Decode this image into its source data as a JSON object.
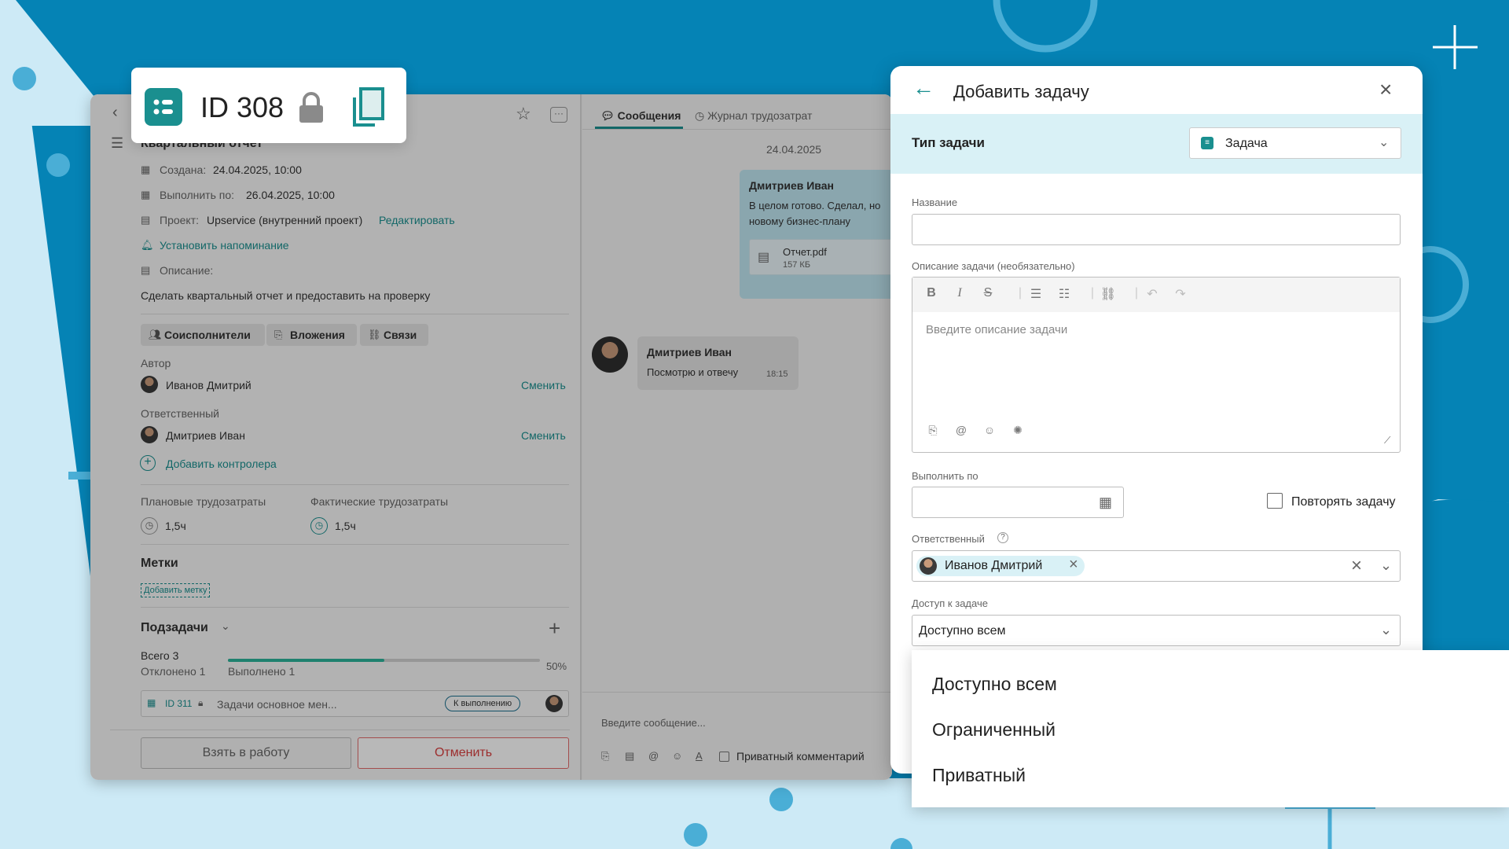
{
  "badge": {
    "id_label": "ID 308",
    "lock_icon": "lock-icon",
    "copy_icon": "copy-icon",
    "task_icon": "task-list-icon"
  },
  "task": {
    "title": "Квартальный отчет",
    "created_label": "Создана:",
    "created_value": "24.04.2025, 10:00",
    "due_label": "Выполнить по:",
    "due_value": "26.04.2025, 10:00",
    "project_label": "Проект:",
    "project_value": "Upservice (внутренний проект)",
    "project_edit": "Редактировать",
    "reminder": "Установить напоминание",
    "description_label": "Описание:",
    "description_value": "Сделать квартальный отчет и предоставить на проверку",
    "chips": [
      "Соисполнители",
      "Вложения",
      "Связи"
    ],
    "author_label": "Автор",
    "author_name": "Иванов Дмитрий",
    "change": "Сменить",
    "responsible_label": "Ответственный",
    "responsible_name": "Дмитриев Иван",
    "add_controller": "Добавить контролера",
    "planned_label": "Плановые трудозатраты",
    "planned_value": "1,5ч",
    "actual_label": "Фактические трудозатраты",
    "actual_value": "1,5ч",
    "tags_label": "Метки",
    "add_tag": "Добавить метку",
    "subtasks_label": "Подзадачи",
    "total": "Всего 3",
    "rejected": "Отклонено 1",
    "done": "Выполнено 1",
    "progress_text": "50%",
    "progress": 0.5,
    "subtask_id": "ID 311",
    "subtask_title": "Задачи основное мен...",
    "subtask_status": "К выполнению",
    "take_button": "Взять в работу",
    "cancel_button": "Отменить"
  },
  "chat": {
    "tab_messages": "Сообщения",
    "tab_log": "Журнал трудозатрат",
    "date": "24.04.2025",
    "msg1_author": "Дмитриев Иван",
    "msg1_text_1": "В целом готово. Сделал, но",
    "msg1_text_2": "новому бизнес-плану",
    "file_name": "Отчет.pdf",
    "file_size": "157 КБ",
    "msg2_author": "Дмитриев Иван",
    "msg2_text": "Посмотрю и отвечу",
    "msg2_time": "18:15",
    "input_placeholder": "Введите сообщение...",
    "private_label": "Приватный комментарий"
  },
  "panel": {
    "title": "Добавить задачу",
    "type_label": "Тип задачи",
    "type_value": "Задача",
    "name_label": "Название",
    "name_value": "",
    "desc_label": "Описание задачи (необязательно)",
    "desc_placeholder": "Введите описание задачи",
    "due_label": "Выполнить по",
    "repeat_label": "Повторять задачу",
    "responsible_label": "Ответственный",
    "responsible_value": "Иванов Дмитрий",
    "access_label": "Доступ к задаче",
    "access_value": "Доступно всем"
  },
  "dropdown": {
    "options": [
      "Доступно всем",
      "Ограниченный",
      "Приватный"
    ]
  },
  "colors": {
    "accent": "#1a8f8f",
    "brand_blue": "#0583b5",
    "danger": "#d94040"
  }
}
